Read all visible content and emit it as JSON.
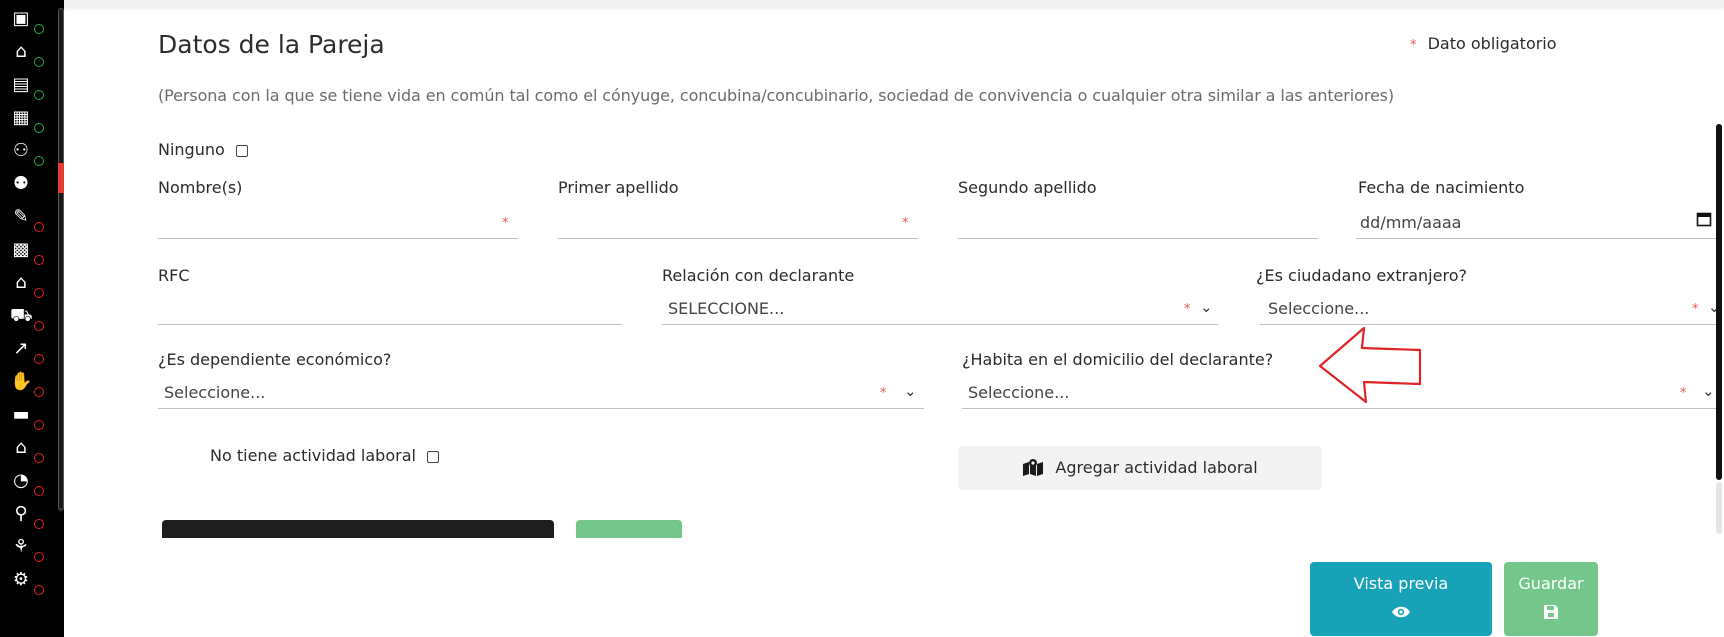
{
  "form": {
    "title": "Datos de la Pareja",
    "required_note": "Dato obligatorio",
    "required_mark": "*",
    "subtitle": "(Persona con la que se tiene vida en común tal como el cónyuge, concubina/concubinario, sociedad de convivencia o cualquier otra similar a las anteriores)",
    "ninguno_label": "Ninguno",
    "nombre_label": "Nombre(s)",
    "primer_apellido_label": "Primer apellido",
    "segundo_apellido_label": "Segundo apellido",
    "fecha_nacimiento_label": "Fecha de nacimiento",
    "fecha_nacimiento_placeholder": "dd/mm/aaaa",
    "rfc_label": "RFC",
    "relacion_label": "Relación con declarante",
    "relacion_value": "SELECCIONE...",
    "extranjero_label": "¿Es ciudadano extranjero?",
    "extranjero_value": "Seleccione...",
    "dependiente_label": "¿Es dependiente económico?",
    "dependiente_value": "Seleccione...",
    "habita_label": "¿Habita en el domicilio del declarante?",
    "habita_value": "Seleccione...",
    "no_actividad_label": "No tiene actividad laboral",
    "agregar_actividad_label": "Agregar actividad laboral"
  },
  "actions": {
    "preview_label": "Vista previa",
    "save_label": "Guardar"
  },
  "sidebar": {
    "items": [
      {
        "icon": "id-card-icon",
        "status": "ok"
      },
      {
        "icon": "home-info-icon",
        "status": "ok"
      },
      {
        "icon": "document-user-icon",
        "status": "ok"
      },
      {
        "icon": "building-user-icon",
        "status": "ok"
      },
      {
        "icon": "network-user-icon",
        "status": "ok"
      },
      {
        "icon": "couple-icon",
        "status": "active"
      },
      {
        "icon": "form-edit-icon",
        "status": "error"
      },
      {
        "icon": "money-photo-icon",
        "status": "error"
      },
      {
        "icon": "house-icon",
        "status": "error"
      },
      {
        "icon": "car-icon",
        "status": "error"
      },
      {
        "icon": "chart-line-icon",
        "status": "error"
      },
      {
        "icon": "hand-money-icon",
        "status": "error"
      },
      {
        "icon": "card-payment-icon",
        "status": "error"
      },
      {
        "icon": "house-money-icon",
        "status": "error"
      },
      {
        "icon": "pie-chart-icon",
        "status": "error"
      },
      {
        "icon": "org-chart-icon",
        "status": "error"
      },
      {
        "icon": "group-globe-icon",
        "status": "error"
      },
      {
        "icon": "group-hierarchy-icon",
        "status": "error"
      }
    ]
  },
  "colors": {
    "accent_teal": "#17a2b8",
    "accent_green": "#74c68a",
    "required_red": "#e05a5a",
    "status_ok": "#21b14a",
    "status_error": "#e02424"
  }
}
